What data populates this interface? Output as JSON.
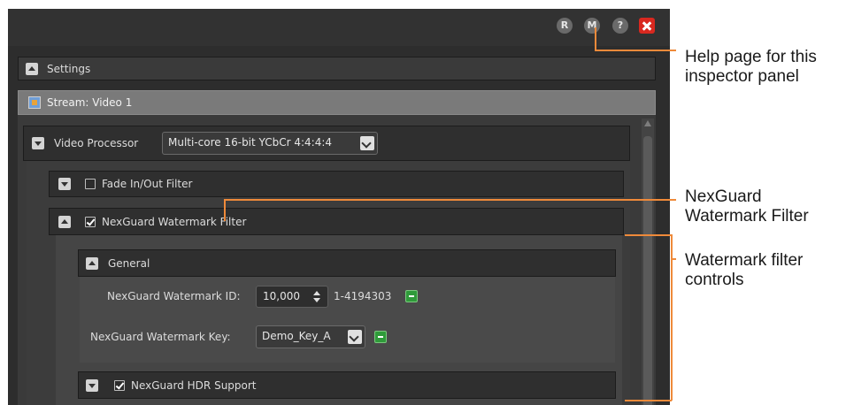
{
  "window": {
    "buttons": {
      "r": "R",
      "m": "M",
      "help": "?"
    }
  },
  "settings": {
    "label": "Settings"
  },
  "stream": {
    "label": "Stream: Video 1"
  },
  "video_processor": {
    "label": "Video Processor",
    "value": "Multi-core 16-bit YCbCr 4:4:4:4"
  },
  "fade_filter": {
    "label": "Fade In/Out Filter",
    "checked": false
  },
  "nexguard_filter": {
    "label": "NexGuard Watermark Filter",
    "checked": true
  },
  "general": {
    "label": "General",
    "watermark_id": {
      "label": "NexGuard Watermark ID:",
      "value": "10,000",
      "range": "1-4194303"
    },
    "watermark_key": {
      "label": "NexGuard Watermark Key:",
      "value": "Demo_Key_A"
    }
  },
  "hdr": {
    "label": "NexGuard HDR Support",
    "checked": true
  },
  "callouts": {
    "help": {
      "line1": "Help page for this",
      "line2": "inspector panel"
    },
    "filter": {
      "line1": "NexGuard",
      "line2": "Watermark Filter"
    },
    "controls": {
      "line1": "Watermark filter",
      "line2": "controls"
    }
  },
  "colors": {
    "accent": "#ef8a3a",
    "close": "#d9281f",
    "green": "#2f9b3a",
    "panel": "#2d2d2d"
  }
}
